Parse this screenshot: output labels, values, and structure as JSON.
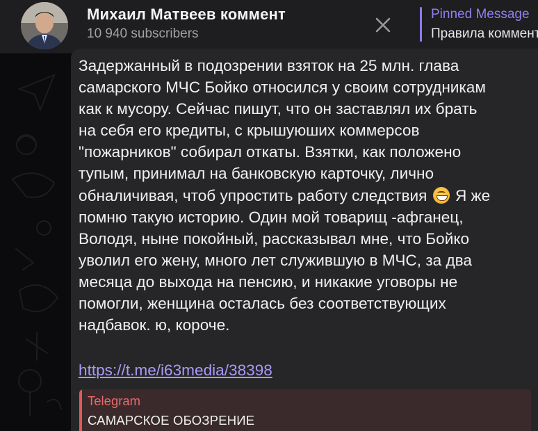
{
  "header": {
    "channel_title": "Михаил Матвеев коммент",
    "subscribers": "10 940 subscribers",
    "close_icon": "close-icon",
    "pinned": {
      "label": "Pinned Message",
      "text": "Правила комментариев"
    }
  },
  "message": {
    "lines": [
      "Задержанный в подозрении взяток на 25 млн. глава",
      "самарского МЧС Бойко относился у своим сотрудникам",
      "как к мусору. Сейчас пишут, что он заставлял их брать",
      "на себя его кредиты, с крышуюших коммерсов",
      "\"пожарников\" собирал откаты. Взятки, как положено",
      "тупым, принимал на банковскую карточку, лично",
      "обналичивая, чтоб упростить работу следствия",
      "помню такую историю. Один мой товарищ -афганец,",
      "Володя, ныне покойный, рассказывал мне, что Бойко",
      "уволил его жену, много лет служившую в МЧС, за два",
      "месяца до выхода на пенсию, и никакие уговоры не",
      "помогли, женщина осталась без соответствующих",
      "надбавок.       ю, короче."
    ],
    "line7_tail": " Я же",
    "emoji": "grinning-face-emoji",
    "link": "https://t.me/i63media/38398",
    "preview": {
      "site": "Telegram",
      "title": "САМАРСКОЕ ОБОЗРЕНИЕ"
    }
  },
  "colors": {
    "header_bg": "#1e1e20",
    "bubble_bg": "#262628",
    "accent": "#8f80f2",
    "link": "#a99af5",
    "preview_accent": "#e05a5a"
  }
}
